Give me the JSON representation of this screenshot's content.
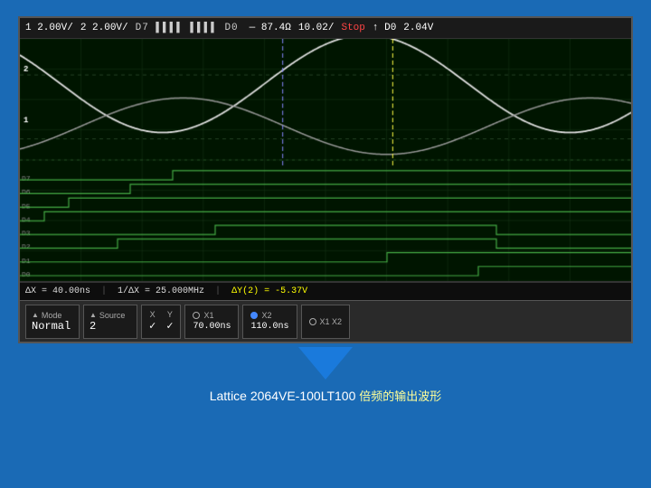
{
  "status_bar": {
    "ch1": "1 2.00V/",
    "ch2": "2 2.00V/",
    "trigger_info": "D7 ████ ████ D0",
    "freq": "87.4Ω",
    "timebase": "10.02/",
    "stop": "Stop",
    "arrow": "↑",
    "ref": "D0",
    "voltage": "2.04V"
  },
  "measurement_bar": {
    "delta_x": "ΔX = 40.00ns",
    "inv_delta_x": "1/ΔX = 25.000MHz",
    "delta_y2": "ΔY(2) = -5.37V"
  },
  "control_panel": {
    "mode_label": "Mode",
    "mode_value": "Normal",
    "source_label": "Source",
    "source_value": "2",
    "x_label": "X",
    "x_value": "✓",
    "y_label": "Y",
    "y_value": "✓",
    "x1_label": "X1",
    "x1_value": "70.00ns",
    "x2_label": "X2",
    "x2_value": "110.0ns",
    "x1x2_label": "X1 X2"
  },
  "caption": {
    "main": "Lattice 2064VE-100LT100",
    "sub": "倍频的输出波形"
  },
  "grid": {
    "cols": 10,
    "rows": 8,
    "color": "#1a4a1a",
    "line_color": "#1f5a1f"
  },
  "waveforms": {
    "analog1": {
      "color": "#ffffff",
      "description": "Channel 1 sine wave"
    },
    "analog2": {
      "color": "#cccccc",
      "description": "Channel 2 sine wave offset"
    },
    "digital_channels": [
      {
        "label": "D7",
        "y_ratio": 0.56
      },
      {
        "label": "D6",
        "y_ratio": 0.61
      },
      {
        "label": "D5",
        "y_ratio": 0.66
      },
      {
        "label": "D4",
        "y_ratio": 0.71
      },
      {
        "label": "D3",
        "y_ratio": 0.76
      },
      {
        "label": "D2",
        "y_ratio": 0.81
      },
      {
        "label": "D1",
        "y_ratio": 0.86
      },
      {
        "label": "D0",
        "y_ratio": 0.91
      }
    ],
    "cursor_x1": 0.45,
    "cursor_x2": 0.62
  }
}
